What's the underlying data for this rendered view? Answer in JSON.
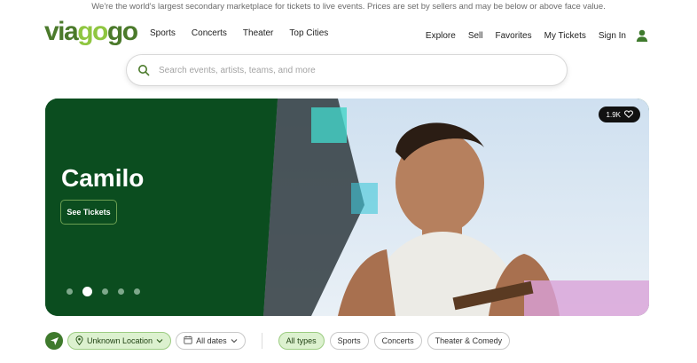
{
  "top_banner": "We're the world's largest secondary marketplace for tickets to live events. Prices are set by sellers and may be below or above face value.",
  "logo": {
    "part1": "via",
    "part2": "go",
    "part3": "go"
  },
  "nav_left": [
    "Sports",
    "Concerts",
    "Theater",
    "Top Cities"
  ],
  "nav_right": [
    "Explore",
    "Sell",
    "Favorites",
    "My Tickets",
    "Sign In"
  ],
  "search": {
    "placeholder": "Search events, artists, teams, and more",
    "value": ""
  },
  "hero": {
    "title": "Camilo",
    "button_label": "See Tickets",
    "likes": "1.9K",
    "carousel_count": 5,
    "carousel_active": 2
  },
  "filters": {
    "location": "Unknown Location",
    "dates": "All dates",
    "types": [
      "All types",
      "Sports",
      "Concerts",
      "Theater & Comedy"
    ],
    "active_type": "All types"
  },
  "colors": {
    "brand_dark": "#4b7a2b",
    "brand_light": "#8fc640",
    "hero_panel": "#0b4d1f",
    "pill_active": "#dcf1cf"
  },
  "icons": {
    "search": "search-icon",
    "user": "user-icon",
    "heart": "heart-icon",
    "location_arrow": "location-arrow-icon",
    "pin": "map-pin-icon",
    "calendar": "calendar-icon",
    "chevron": "chevron-down-icon"
  }
}
